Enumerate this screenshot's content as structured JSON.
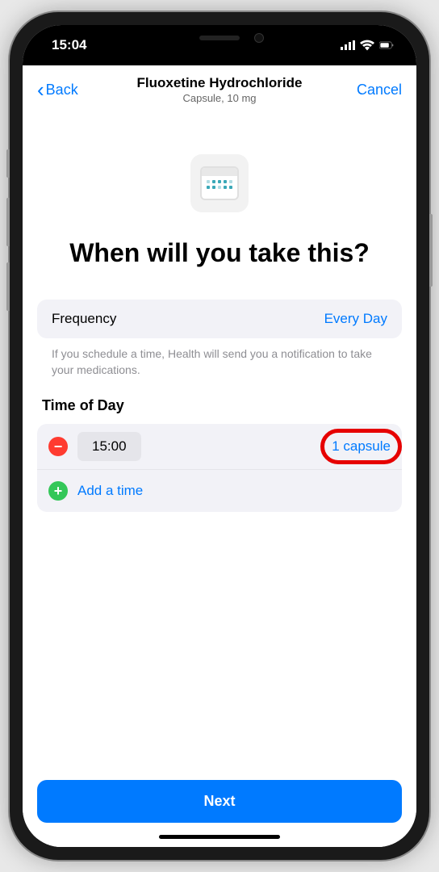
{
  "status_bar": {
    "time": "15:04"
  },
  "header": {
    "back_label": "Back",
    "title": "Fluoxetine Hydrochloride",
    "subtitle": "Capsule, 10 mg",
    "cancel_label": "Cancel"
  },
  "main": {
    "heading": "When will you take this?"
  },
  "frequency": {
    "label": "Frequency",
    "value": "Every Day"
  },
  "info_text": "If you schedule a time, Health will send you a notification to take your medications.",
  "time_of_day": {
    "section_title": "Time of Day",
    "rows": [
      {
        "time": "15:00",
        "dose": "1 capsule"
      }
    ],
    "add_label": "Add a time"
  },
  "footer": {
    "next_label": "Next"
  }
}
